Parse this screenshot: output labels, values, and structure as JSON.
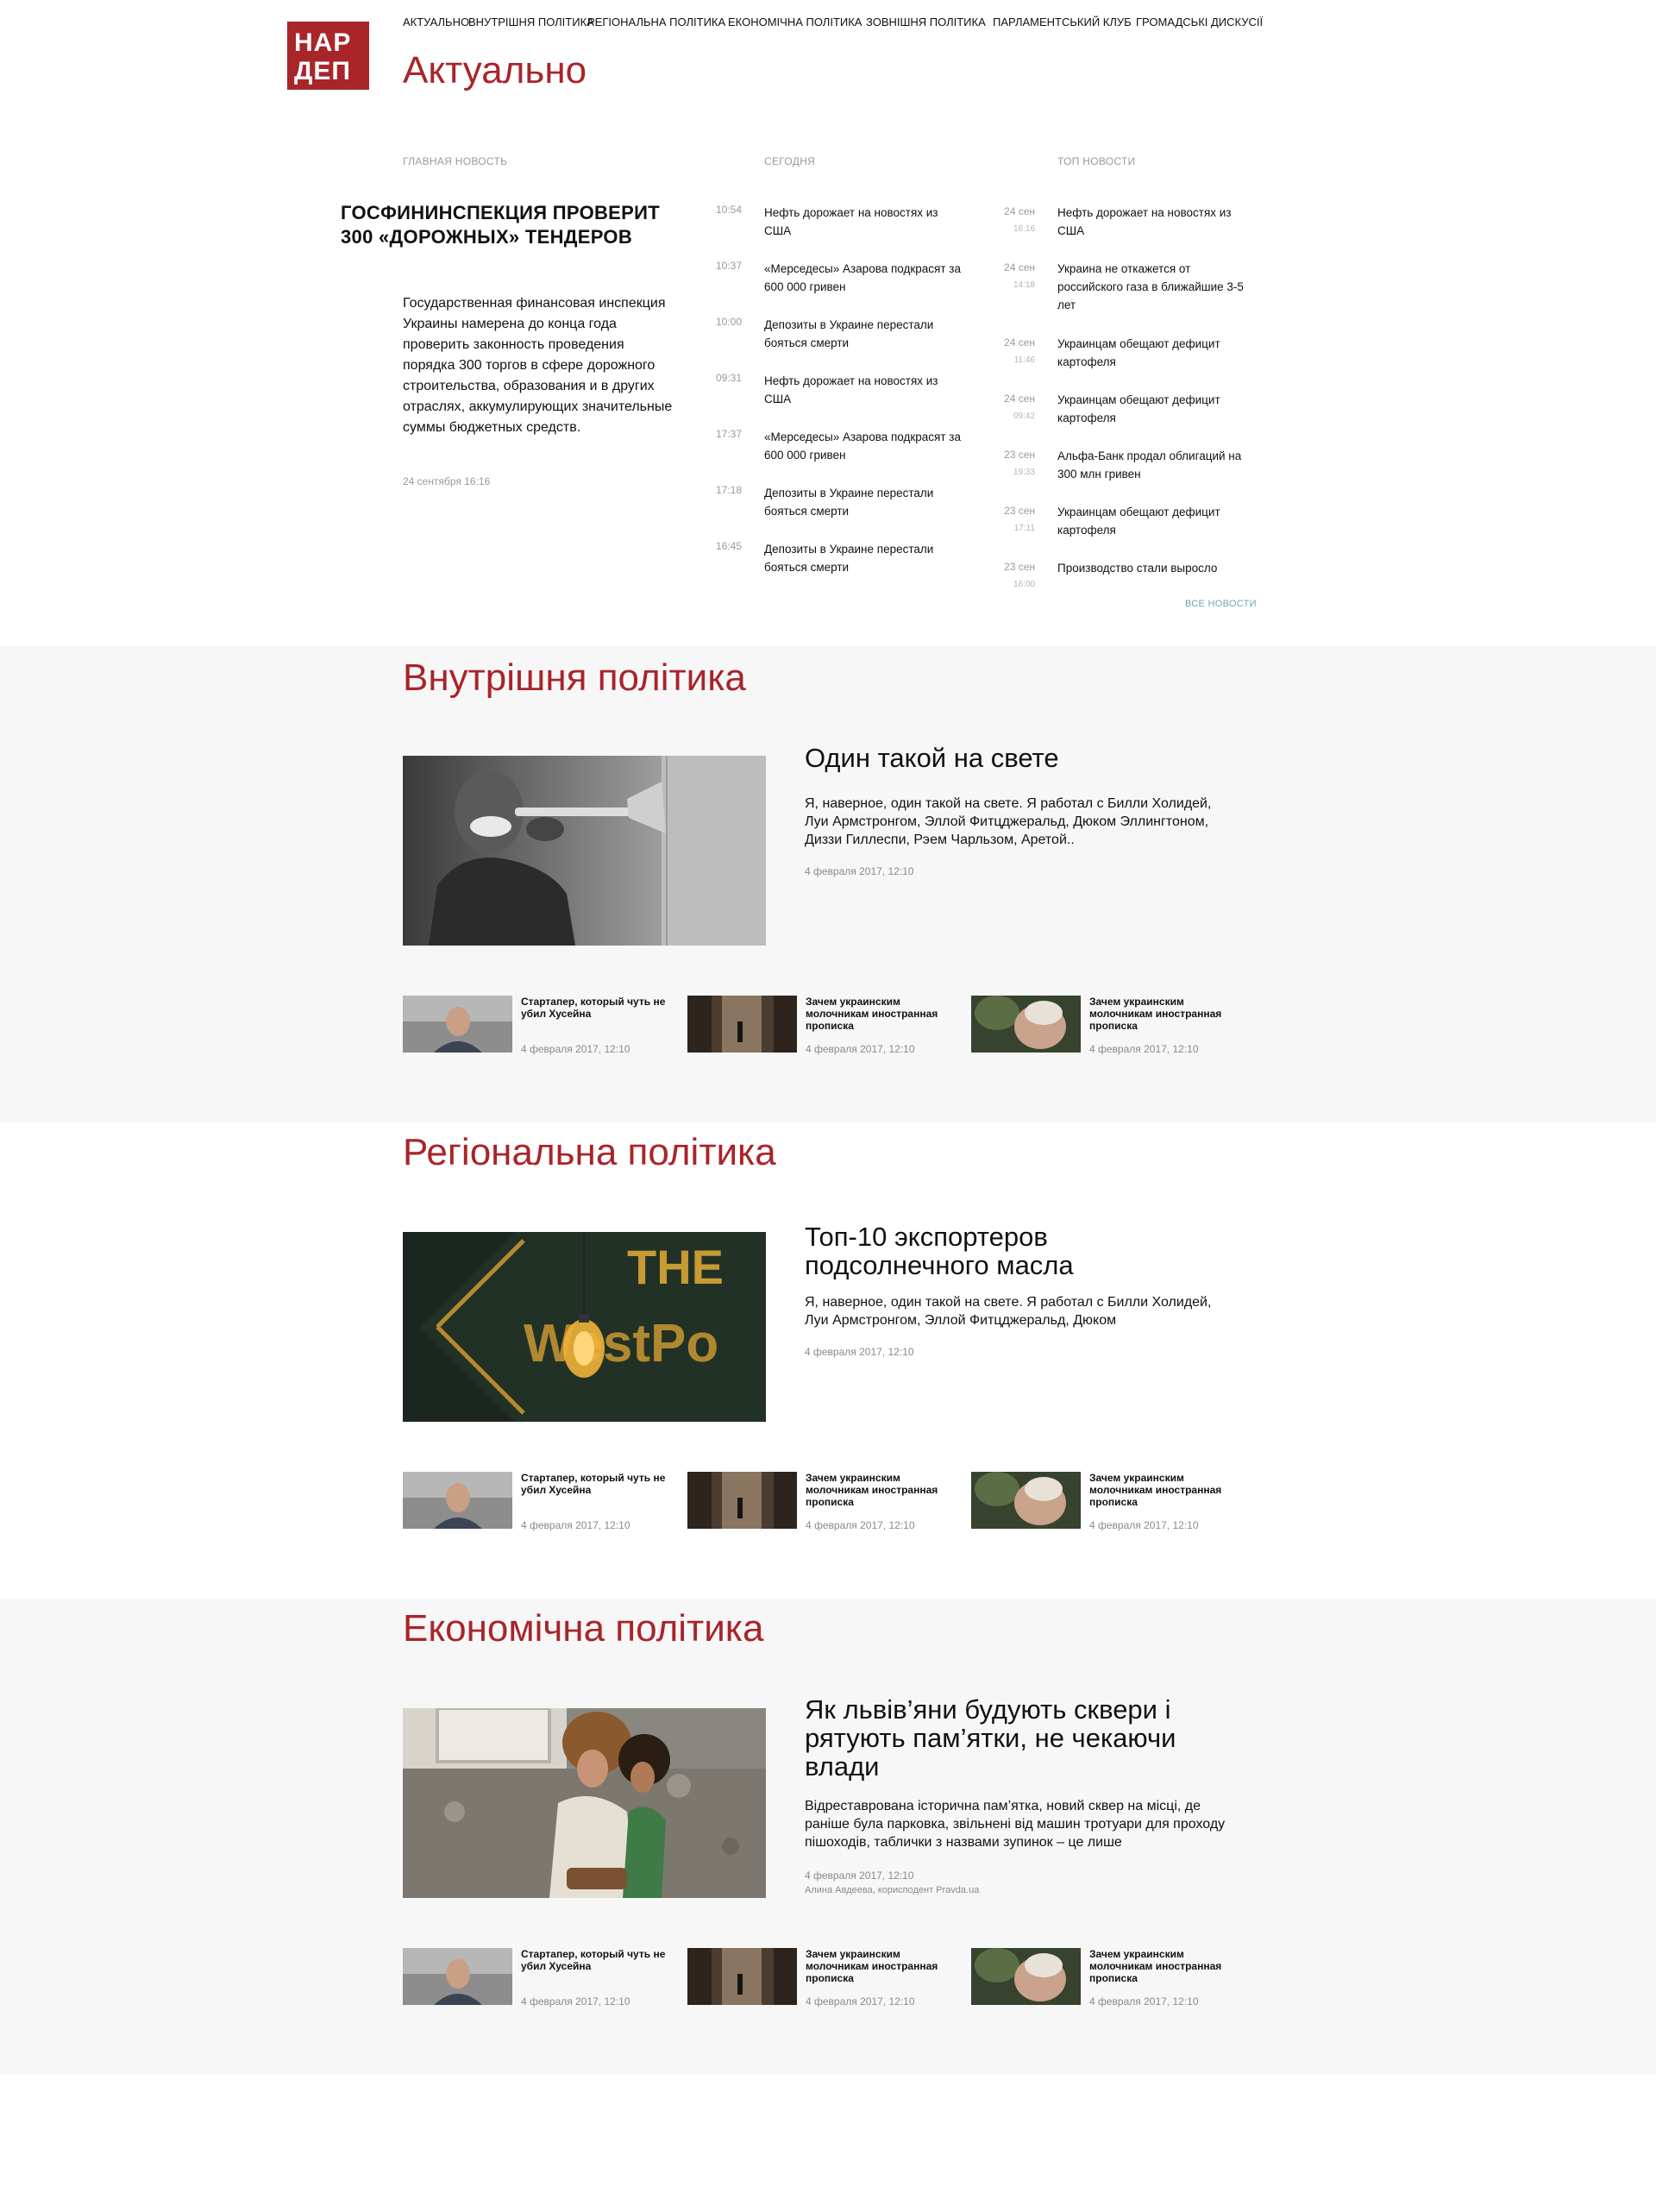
{
  "logo": {
    "line1": "НАР",
    "line2": "ДЕП"
  },
  "nav": [
    "АКТУАЛЬНО",
    "ВНУТРІШНЯ ПОЛІТИКА",
    "РЕГІОНАЛЬНА ПОЛІТИКА",
    "ЕКОНОМІЧНА ПОЛІТИКА",
    "ЗОВНІШНЯ ПОЛІТИКА",
    "ПАРЛАМЕНТСЬКИЙ КЛУБ",
    "ГРОМАДСЬКІ ДИСКУСІЇ"
  ],
  "actual": {
    "title": "Актуально",
    "main_head": "ГЛАВНАЯ НОВОСТЬ",
    "today_head": "СЕГОДНЯ",
    "top_head": "ТОП НОВОСТИ",
    "main": {
      "headline": "ГОСФИНИНСПЕКЦИЯ ПРОВЕРИТ 300 «ДОРОЖНЫХ» ТЕНДЕРОВ",
      "body": "Государственная финансовая инспекция Украины намерена до конца года проверить законность проведения порядка 300 торгов в сфере дорожного строительства, образования и в других отраслях, аккумулирующих значительные суммы бюджетных средств.",
      "date": "24 сентября 16:16"
    },
    "today": [
      {
        "time": "10:54",
        "text": "Нефть дорожает на новостях из США"
      },
      {
        "time": "10:37",
        "text": "«Мерседесы» Азарова подкрасят за 600 000 гривен"
      },
      {
        "time": "10:00",
        "text": "Депозиты в Украине перестали бояться смерти"
      },
      {
        "time": "09:31",
        "text": "Нефть дорожает на новостях из США"
      },
      {
        "time": "17:37",
        "text": "«Мерседесы» Азарова подкрасят за 600 000 гривен"
      },
      {
        "time": "17:18",
        "text": "Депозиты в Украине перестали бояться смерти"
      },
      {
        "time": "16:45",
        "text": "Депозиты в Украине перестали бояться смерти"
      }
    ],
    "top": [
      {
        "date": "24 сен",
        "time": "16:16",
        "text": "Нефть дорожает на новостях из США"
      },
      {
        "date": "24 сен",
        "time": "14:18",
        "text": "Украина не откажется от российского газа в ближайшие 3-5 лет"
      },
      {
        "date": "24 сен",
        "time": "11:46",
        "text": "Украинцам обещают дефицит картофеля"
      },
      {
        "date": "24 сен",
        "time": "09:42",
        "text": "Украинцам обещают дефицит картофеля"
      },
      {
        "date": "23 сен",
        "time": "19:33",
        "text": "Альфа-Банк продал облигаций на 300 млн гривен"
      },
      {
        "date": "23 сен",
        "time": "17:11",
        "text": "Украинцам обещают дефицит картофеля"
      },
      {
        "date": "23 сен",
        "time": "16:00",
        "text": "Производство стали выросло"
      }
    ],
    "all_news": "ВСЕ НОВОСТИ"
  },
  "sections": [
    {
      "title": "Внутрішня політика",
      "hero": {
        "title": "Один такой на свете",
        "text": "Я, наверное, один такой на свете. Я работал с Билли Холидей, Луи Армстронгом, Эллой Фитцджеральд, Дюком Эллингтоном, Диззи Гиллеспи, Рэем Чарльзом, Аретой..",
        "date": "4 февраля 2017, 12:10"
      },
      "cards": [
        {
          "title": "Стартапер, который чуть не убил Хусейна",
          "date": "4 февраля 2017, 12:10"
        },
        {
          "title": "Зачем украинским молочникам иностранная прописка",
          "date": "4 февраля 2017, 12:10"
        },
        {
          "title": "Зачем украинским молочникам иностранная прописка",
          "date": "4 февраля 2017, 12:10"
        }
      ]
    },
    {
      "title": "Регіональна політика",
      "hero": {
        "title": "Топ-10 экспортеров подсолнечного масла",
        "text": "Я, наверное, один такой на свете. Я работал с Билли Холидей, Луи Армстронгом, Эллой Фитцджеральд, Дюком",
        "date": "4 февраля 2017, 12:10"
      },
      "cards": [
        {
          "title": "Стартапер, который чуть не убил Хусейна",
          "date": "4 февраля 2017, 12:10"
        },
        {
          "title": "Зачем украинским молочникам иностранная прописка",
          "date": "4 февраля 2017, 12:10"
        },
        {
          "title": "Зачем украинским молочникам иностранная прописка",
          "date": "4 февраля 2017, 12:10"
        }
      ]
    },
    {
      "title": "Економічна політика",
      "hero": {
        "title": "Як львів’яни будують сквери і рятують пам’ятки, не чекаючи влади",
        "text": "Відреставрована історична пам’ятка, новий сквер на місці, де раніше була парковка, звільнені від машин тротуари для проходу пішоходів, таблички з назвами зупинок – це лише",
        "date": "4 февраля 2017, 12:10",
        "author": "Алина Авдеева, корисподент Pravda.ua"
      },
      "cards": [
        {
          "title": "Стартапер, который чуть не убил Хусейна",
          "date": "4 февраля 2017, 12:10"
        },
        {
          "title": "Зачем украинским молочникам иностранная прописка",
          "date": "4 февраля 2017, 12:10"
        },
        {
          "title": "Зачем украинским молочникам иностранная прописка",
          "date": "4 февраля 2017, 12:10"
        }
      ]
    }
  ],
  "colors": {
    "accent": "#a8252a",
    "band": "#f7f7f7",
    "link": "#6ea7b8"
  }
}
